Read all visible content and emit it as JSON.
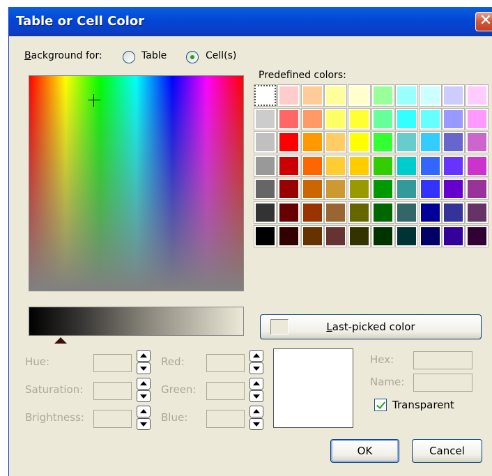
{
  "window": {
    "title": "Table or Cell Color",
    "close_label": "✕"
  },
  "background_for": {
    "label_prefix": "B",
    "label_rest": "ackground for:",
    "options": [
      {
        "label": "Table",
        "selected": false
      },
      {
        "label": "Cell(s)",
        "selected": true
      }
    ]
  },
  "predefined": {
    "label": "Predefined colors:",
    "selected_index": 0,
    "colors": [
      "#ffffff",
      "#ffcccc",
      "#ffcc99",
      "#ffff99",
      "#ffffcc",
      "#99ff99",
      "#99ffff",
      "#ccffff",
      "#ccccff",
      "#ffccff",
      "#cccccc",
      "#ff6666",
      "#ff9966",
      "#ffff66",
      "#ffff33",
      "#66ff99",
      "#33ffff",
      "#66ffff",
      "#9999ff",
      "#ff99ff",
      "#c0c0c0",
      "#ff0000",
      "#ff9900",
      "#ffcc66",
      "#ffff00",
      "#33ff33",
      "#66cccc",
      "#33ccff",
      "#6666cc",
      "#cc66cc",
      "#999999",
      "#cc0000",
      "#ff6600",
      "#ffcc33",
      "#ffcc00",
      "#33cc00",
      "#00cccc",
      "#3366ff",
      "#6633ff",
      "#cc33cc",
      "#666666",
      "#990000",
      "#cc6600",
      "#cc9933",
      "#999900",
      "#009900",
      "#339999",
      "#3333ff",
      "#6600cc",
      "#993399",
      "#333333",
      "#660000",
      "#993300",
      "#996633",
      "#666600",
      "#006600",
      "#336666",
      "#000099",
      "#333399",
      "#663366",
      "#000000",
      "#330000",
      "#663300",
      "#663333",
      "#333300",
      "#003300",
      "#003333",
      "#000066",
      "#330099",
      "#330033"
    ]
  },
  "last_picked": {
    "label_prefix": "L",
    "label_rest": "ast-picked color"
  },
  "fields": {
    "hue": "Hue:",
    "saturation": "Saturation:",
    "brightness": "Brightness:",
    "red": "Red:",
    "green": "Green:",
    "blue": "Blue:",
    "hex": "Hex:",
    "name": "Name:"
  },
  "transparent": {
    "label": "Transparent",
    "checked": true
  },
  "buttons": {
    "ok": "OK",
    "cancel": "Cancel"
  },
  "brightness_level": 0.15
}
